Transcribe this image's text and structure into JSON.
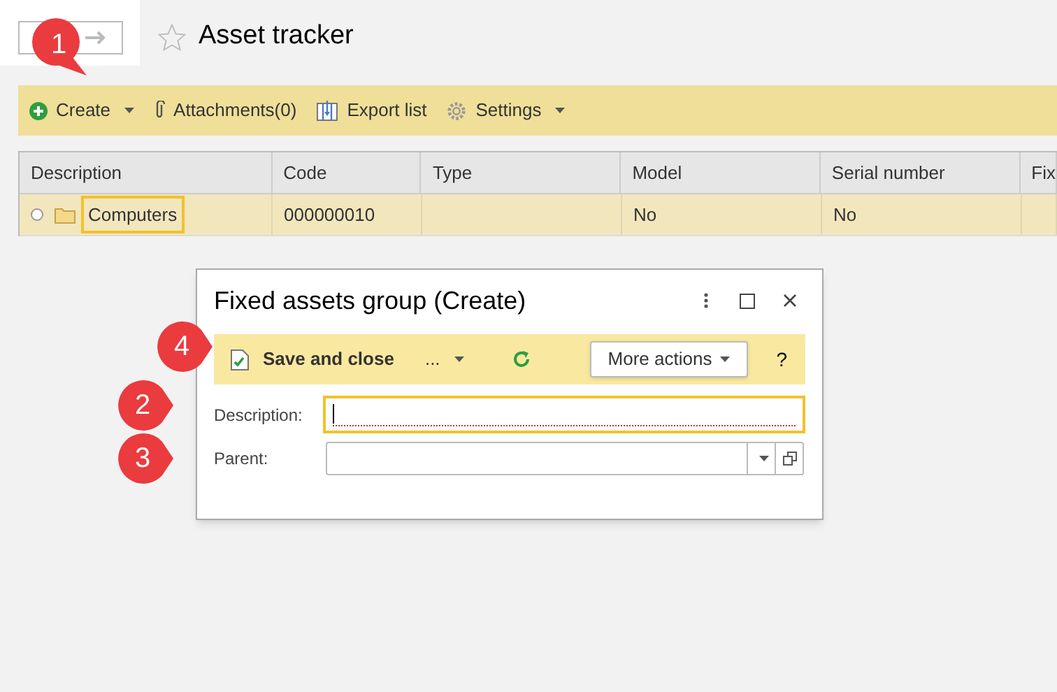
{
  "page": {
    "title": "Asset tracker",
    "favorite": false
  },
  "toolbar": [
    {
      "kind": "create",
      "label": "Create",
      "dropdown": true
    },
    {
      "kind": "attach",
      "label": "Attachments(0)",
      "dropdown": false
    },
    {
      "kind": "export",
      "label": "Export list",
      "dropdown": false
    },
    {
      "kind": "settings",
      "label": "Settings",
      "dropdown": true
    }
  ],
  "table": {
    "columns": [
      "Description",
      "Code",
      "Type",
      "Model",
      "Serial number",
      "Fix"
    ],
    "rows": [
      {
        "selected": true,
        "cells": [
          "Computers",
          "000000010",
          "",
          "No",
          "No",
          ""
        ]
      }
    ]
  },
  "dialog": {
    "title": "Fixed assets group (Create)",
    "toolbar": {
      "save": "Save and close",
      "more_dots": "...",
      "more_actions": "More actions",
      "help": "?"
    },
    "fields": [
      {
        "kind": "text",
        "label": "Description:",
        "focused": true,
        "required": true
      },
      {
        "kind": "select",
        "label": "Parent:",
        "focused": false,
        "required": false
      }
    ]
  },
  "callouts": [
    {
      "number": "1"
    },
    {
      "number": "2"
    },
    {
      "number": "3"
    },
    {
      "number": "4"
    }
  ]
}
